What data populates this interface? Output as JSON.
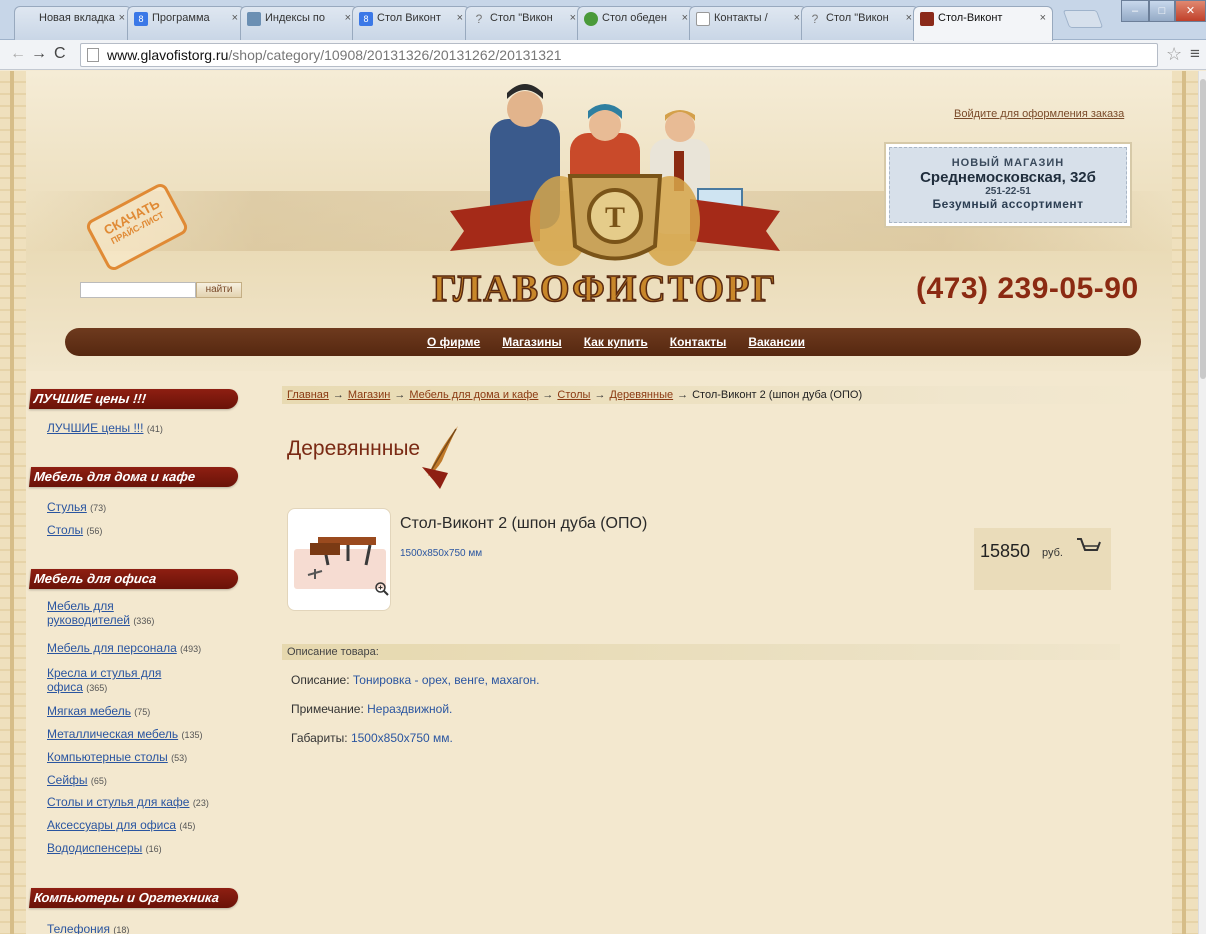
{
  "browser": {
    "tabs": [
      {
        "label": "Новая вкладка",
        "favicon": "blank",
        "close": "×"
      },
      {
        "label": "Программа",
        "favicon": "g",
        "close": "×"
      },
      {
        "label": "Индексы по",
        "favicon": "blue",
        "close": "×"
      },
      {
        "label": "Стол Виконт",
        "favicon": "g",
        "close": "×"
      },
      {
        "label": "Стол \"Викон",
        "favicon": "q",
        "close": "×"
      },
      {
        "label": "Стол обеден",
        "favicon": "leaf",
        "close": "×"
      },
      {
        "label": "Контакты / ",
        "favicon": "doc",
        "close": "×"
      },
      {
        "label": "Стол \"Викон",
        "favicon": "q",
        "close": "×"
      },
      {
        "label": "Стол-Виконт",
        "favicon": "shop",
        "close": "×"
      }
    ],
    "url_host": "www.glavofistorg.ru",
    "url_path": "/shop/category/10908/20131326/20131262/20131321"
  },
  "header": {
    "pricelist_stamp": "СКАЧАТЬ",
    "pricelist_stamp_sub": "ПРАЙС-ЛИСТ",
    "search_button": "найти",
    "logo_text": "ГЛАВОФИСТОРГ",
    "login_link": "Войдите для оформления заказа",
    "store_banner": {
      "line1": "НОВЫЙ МАГАЗИН",
      "line2": "Среднемосковская, 32б",
      "line3": "251-22-51",
      "line4": "Безумный ассортимент"
    },
    "phone": "(473) 239-05-90"
  },
  "nav": [
    {
      "label": "О фирме"
    },
    {
      "label": "Магазины"
    },
    {
      "label": "Как купить"
    },
    {
      "label": "Контакты"
    },
    {
      "label": "Вакансии"
    }
  ],
  "sidebar": {
    "sections": [
      {
        "title": "ЛУЧШИЕ цены !!!",
        "items": [
          {
            "label": "ЛУЧШИЕ цены !!!",
            "count": "(41)"
          }
        ]
      },
      {
        "title": "Мебель для дома и кафе",
        "items": [
          {
            "label": "Стулья",
            "count": "(73)"
          },
          {
            "label": "Столы",
            "count": "(56)"
          }
        ]
      },
      {
        "title": "Мебель для офиса",
        "items": [
          {
            "label_l1": "Мебель для",
            "label_l2": "руководителей",
            "count": "(336)"
          },
          {
            "label": "Мебель для персонала",
            "count": "(493)"
          },
          {
            "label_l1": "Кресла и стулья для",
            "label_l2": "офиса",
            "count": "(365)"
          },
          {
            "label": "Мягкая мебель",
            "count": "(75)"
          },
          {
            "label": "Металлическая мебель",
            "count": "(135)"
          },
          {
            "label": "Компьютерные столы",
            "count": "(53)"
          },
          {
            "label": "Сейфы",
            "count": "(65)"
          },
          {
            "label": "Столы и стулья для кафе",
            "count": "(23)"
          },
          {
            "label": "Аксессуары для офиса",
            "count": "(45)"
          },
          {
            "label": "Вододиспенсеры",
            "count": "(16)"
          }
        ]
      },
      {
        "title": "Компьютеры и Оргтехника",
        "items": [
          {
            "label": "Телефония",
            "count": "(18)"
          }
        ]
      }
    ]
  },
  "breadcrumb": {
    "items": [
      "Главная",
      "Магазин",
      "Мебель для дома и кафе",
      "Столы",
      "Деревянные"
    ],
    "separator": "→",
    "current": "Стол-Виконт 2 (шпон дуба (ОПО)"
  },
  "content": {
    "page_title": "Деревяннные",
    "product": {
      "name": "Стол-Виконт 2 (шпон дуба (ОПО)",
      "dimensions": "1500x850x750 мм",
      "price": "15850",
      "currency": "руб."
    },
    "description_header": "Описание товара:",
    "description_rows": [
      {
        "label": "Описание:",
        "value": "Тонировка - орех, венге, махагон."
      },
      {
        "label": "Примечание:",
        "value": "Нераздвижной."
      },
      {
        "label": "Габариты:",
        "value": "1500x850x750 мм."
      }
    ]
  },
  "colors": {
    "accent_brown": "#562810",
    "ribbon_red": "#7a160c",
    "link_blue": "#2a55a0",
    "phone_red": "#8b2a12"
  }
}
